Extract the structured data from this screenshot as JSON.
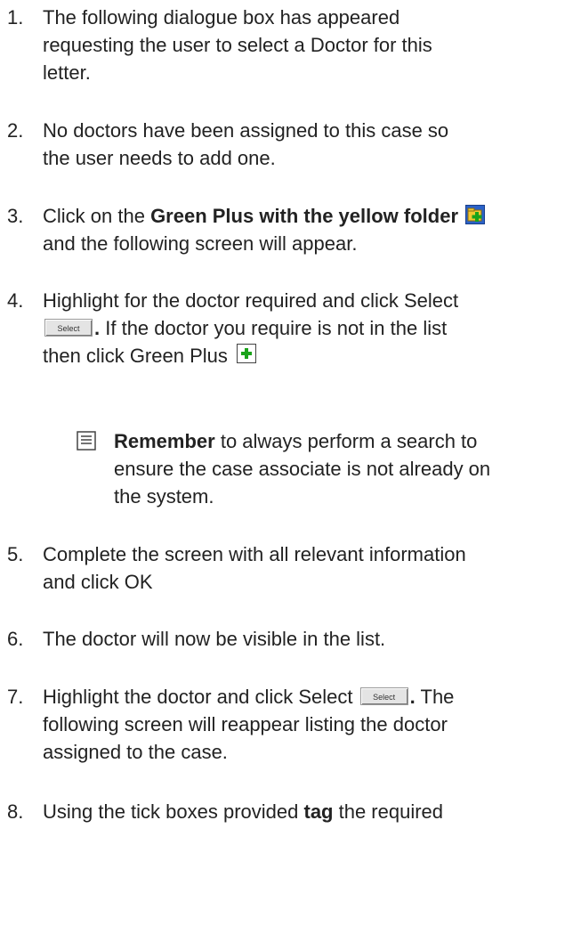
{
  "steps": [
    {
      "num": "1.",
      "lines": [
        "The following dialogue box has appeared",
        "requesting the user to select a Doctor for this",
        "letter."
      ]
    },
    {
      "num": "2.",
      "lines": [
        "No doctors have been assigned to this case so",
        "the user needs to add one."
      ]
    },
    {
      "num": "3.",
      "pre": "Click on the ",
      "bold": "Green Plus with the yellow folder",
      "line2": "and the following screen will appear.",
      "icon": "green-plus-yellow-folder-icon"
    },
    {
      "num": "4.",
      "line1": "Highlight for the doctor required and click Select",
      "button_label": "Select",
      "line2_after": "If the doctor you require is not in the list",
      "line3": "then click Green Plus",
      "icon": "green-plus-icon"
    },
    {
      "num": "5.",
      "lines": [
        "Complete the screen with all relevant information",
        "and click OK"
      ]
    },
    {
      "num": "6.",
      "lines": [
        "The doctor will now be visible in the list."
      ]
    },
    {
      "num": "7.",
      "line1": "Highlight the doctor and click Select",
      "button_label": "Select",
      "line1_after": "The",
      "lines_rest": [
        "following screen will reappear listing the doctor",
        "assigned to the case."
      ]
    },
    {
      "num": "8.",
      "pre": "Using the tick boxes provided ",
      "bold": "tag",
      "post": " the required"
    }
  ],
  "note": {
    "icon": "note-icon",
    "bold": "Remember",
    "rest1": " to always perform a search to",
    "lines": [
      "ensure the case associate is not already on",
      "the system."
    ]
  }
}
